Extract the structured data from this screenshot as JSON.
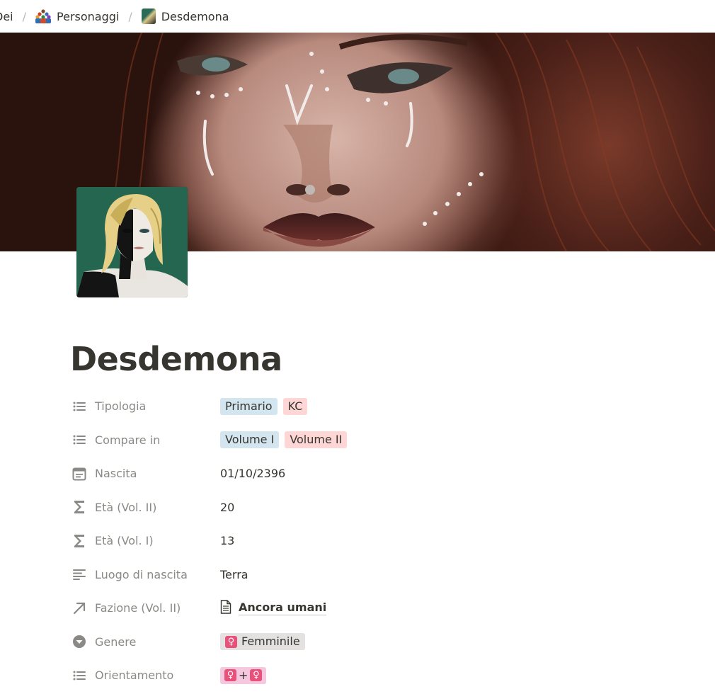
{
  "breadcrumb": {
    "items": [
      {
        "label": "Dei"
      },
      {
        "label": "Personaggi",
        "icon": "people-group-icon"
      },
      {
        "label": "Desdemona",
        "icon": "portrait-thumbnail-icon"
      }
    ],
    "separator": "/"
  },
  "page": {
    "title": "Desdemona"
  },
  "properties": {
    "tipologia": {
      "name": "Tipologia",
      "icon": "list-icon",
      "tags": [
        {
          "label": "Primario",
          "color": "#d3e5ef"
        },
        {
          "label": "KC",
          "color": "#ffd6d6"
        }
      ]
    },
    "compare_in": {
      "name": "Compare in",
      "icon": "list-icon",
      "tags": [
        {
          "label": "Volume I",
          "color": "#d3e5ef"
        },
        {
          "label": "Volume II",
          "color": "#ffd6d6"
        }
      ]
    },
    "nascita": {
      "name": "Nascita",
      "icon": "calendar-icon",
      "value": "01/10/2396"
    },
    "eta_vol2": {
      "name": "Età (Vol. II)",
      "icon": "sigma-icon",
      "value": "20"
    },
    "eta_vol1": {
      "name": "Età (Vol. I)",
      "icon": "sigma-icon",
      "value": "13"
    },
    "luogo": {
      "name": "Luogo di nascita",
      "icon": "text-lines-icon",
      "value": "Terra"
    },
    "fazione": {
      "name": "Fazione (Vol. II)",
      "icon": "arrow-up-right-icon",
      "value": "Ancora umani",
      "value_icon": "document-icon"
    },
    "genere": {
      "name": "Genere",
      "icon": "select-circle-icon",
      "value": "Femminile",
      "symbol": "♀"
    },
    "orientamento": {
      "name": "Orientamento",
      "icon": "list-icon",
      "plus": "+",
      "symbol": "♀"
    }
  },
  "colors": {
    "text": "#37352f",
    "muted": "#8a8985",
    "tag_blue": "#d3e5ef",
    "tag_red": "#ffd6d6",
    "tag_gray": "#e3e2e0",
    "tag_pink": "#f5c8e0",
    "female_symbol": "#e8517a"
  }
}
